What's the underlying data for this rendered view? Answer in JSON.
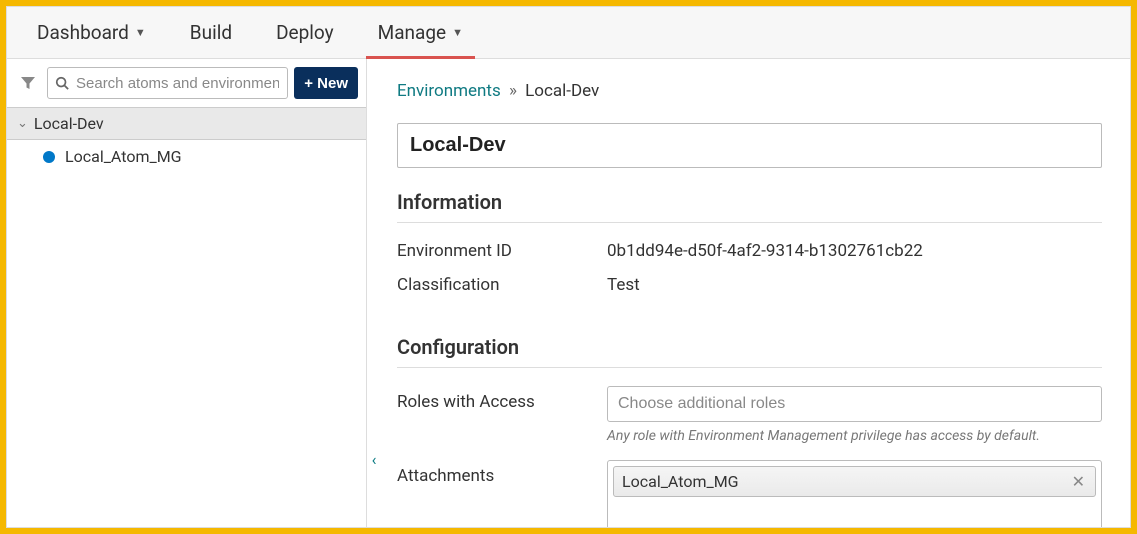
{
  "nav": {
    "dashboard": "Dashboard",
    "build": "Build",
    "deploy": "Deploy",
    "manage": "Manage"
  },
  "sidebar": {
    "search_placeholder": "Search atoms and environments",
    "new_label": "+ New",
    "env_name": "Local-Dev",
    "atom_name": "Local_Atom_MG"
  },
  "breadcrumb": {
    "root": "Environments",
    "sep": "»",
    "current": "Local-Dev"
  },
  "main": {
    "name": "Local-Dev",
    "info_title": "Information",
    "env_id_label": "Environment ID",
    "env_id_value": "0b1dd94e-d50f-4af2-9314-b1302761cb22",
    "class_label": "Classification",
    "class_value": "Test",
    "config_title": "Configuration",
    "roles_label": "Roles with Access",
    "roles_placeholder": "Choose additional roles",
    "roles_hint": "Any role with Environment Management privilege has access by default.",
    "attach_label": "Attachments",
    "attach_chip": "Local_Atom_MG"
  }
}
